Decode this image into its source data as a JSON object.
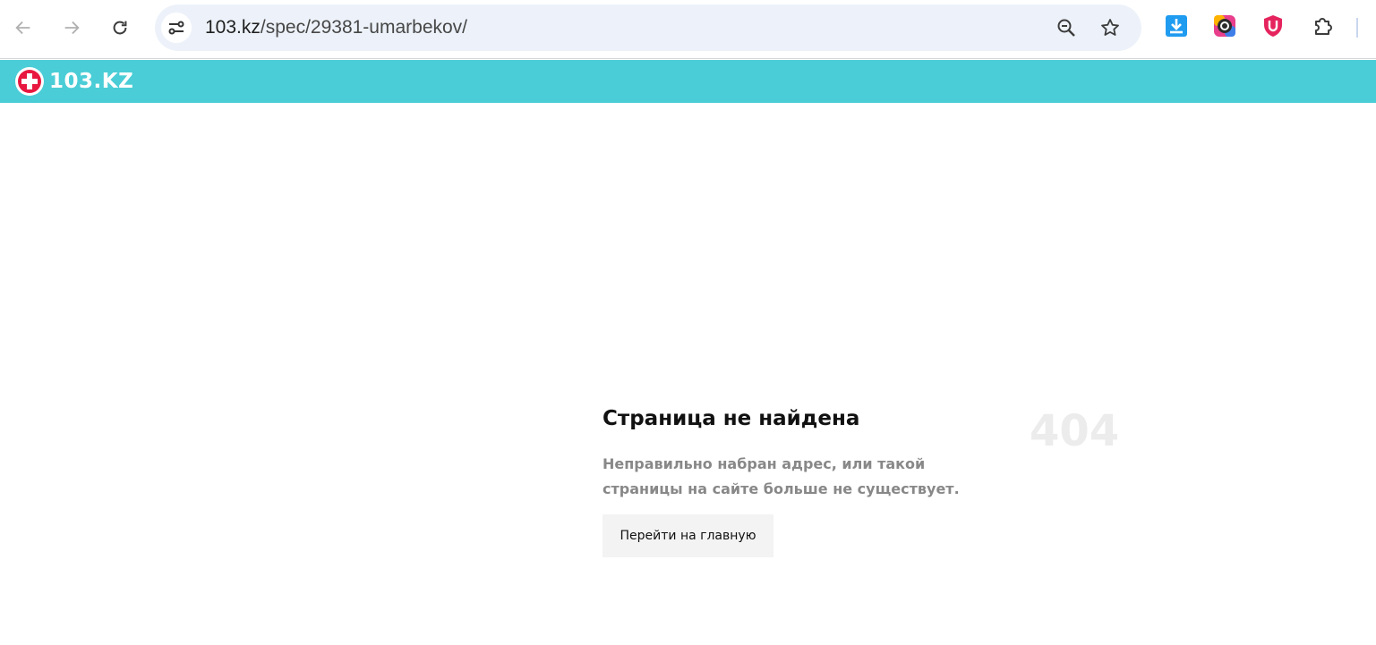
{
  "browser": {
    "url_host": "103.kz",
    "url_path": "/spec/29381-umarbekov/",
    "icons": [
      "back-arrow-icon",
      "forward-arrow-icon",
      "reload-icon",
      "site-info-icon",
      "zoom-icon",
      "bookmark-star-icon",
      "download-extension-icon",
      "camera-extension-icon",
      "shield-extension-icon",
      "extensions-puzzle-icon"
    ]
  },
  "site": {
    "logo_text": "103.KZ",
    "header_color": "#4acdd6",
    "logo_cross_color": "#e8173f"
  },
  "not_found": {
    "title": "Страница не найдена",
    "code": "404",
    "message": "Неправильно набран адрес, или такой страницы на сайте больше не существует.",
    "button_label": "Перейти на главную"
  }
}
